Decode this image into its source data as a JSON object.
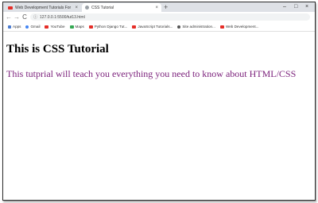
{
  "tabs": [
    {
      "title": "Web Development Tutorials For",
      "close": "×",
      "active": false
    },
    {
      "title": "CSS Tutorial",
      "close": "×",
      "active": true
    }
  ],
  "new_tab": "+",
  "window_controls": {
    "minimize": "–",
    "maximize": "□",
    "close": "×"
  },
  "toolbar": {
    "back": "←",
    "forward": "→",
    "reload": "C",
    "info_icon": "ⓘ"
  },
  "address": {
    "url": "127.0.0.1:5500/tut13.html"
  },
  "bookmarks": [
    {
      "label": "Apps",
      "icon": "apps-icon"
    },
    {
      "label": "Gmail",
      "icon": "google-icon"
    },
    {
      "label": "YouTube",
      "icon": "youtube-icon"
    },
    {
      "label": "Maps",
      "icon": "maps-icon"
    },
    {
      "label": "Python Django Tut...",
      "icon": "youtube-icon"
    },
    {
      "label": "JavaScript Tutorials...",
      "icon": "youtube-icon"
    },
    {
      "label": "Site administration...",
      "icon": "globe-icon"
    },
    {
      "label": "Web Development...",
      "icon": "youtube-icon"
    }
  ],
  "page": {
    "heading": "This is CSS Tutorial",
    "paragraph": "This tutprial will teach you everything you need to know about HTML/CSS"
  },
  "colors": {
    "paragraph": "#7a1f7a",
    "tabstrip": "#dee1e6"
  }
}
